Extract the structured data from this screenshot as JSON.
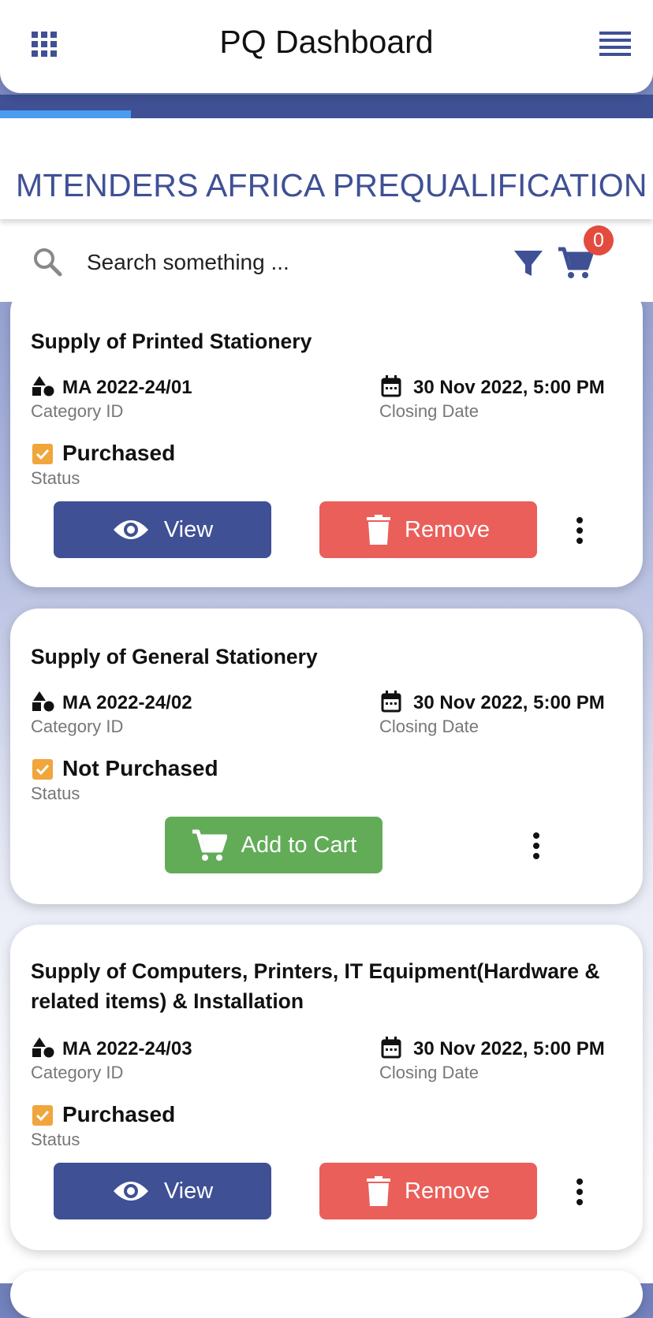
{
  "header": {
    "title": "PQ Dashboard",
    "left_icon": "apps-grid-icon",
    "right_icon": "menu-icon"
  },
  "progress": {
    "fraction": 0.2
  },
  "section": {
    "title": "MTENDERS AFRICA PREQUALIFICATION"
  },
  "search": {
    "placeholder": "Search something ...",
    "cart_count": "0"
  },
  "colors": {
    "primary": "#3f5095",
    "remove": "#ea5f5a",
    "add_cart": "#62ac58",
    "check": "#f0a63c",
    "badge": "#e34b3f"
  },
  "cards": [
    {
      "title": "Supply of Printed Stationery",
      "category_id": "MA 2022-24/01",
      "category_label": "Category ID",
      "closing_date": "30 Nov  2022, 5:00 PM",
      "closing_label": "Closing Date",
      "status": "Purchased",
      "status_label": "Status",
      "view_label": "View",
      "remove_label": "Remove"
    },
    {
      "title": "Supply of General Stationery",
      "category_id": "MA 2022-24/02",
      "category_label": "Category ID",
      "closing_date": "30 Nov  2022, 5:00 PM",
      "closing_label": "Closing Date",
      "status": "Not Purchased",
      "status_label": "Status",
      "add_cart_label": "Add to Cart"
    },
    {
      "title": "Supply of Computers, Printers, IT Equipment(Hardware & related items) & Installation",
      "category_id": "MA 2022-24/03",
      "category_label": "Category ID",
      "closing_date": "30 Nov  2022, 5:00 PM",
      "closing_label": "Closing Date",
      "status": "Purchased",
      "status_label": "Status",
      "view_label": "View",
      "remove_label": "Remove"
    }
  ]
}
